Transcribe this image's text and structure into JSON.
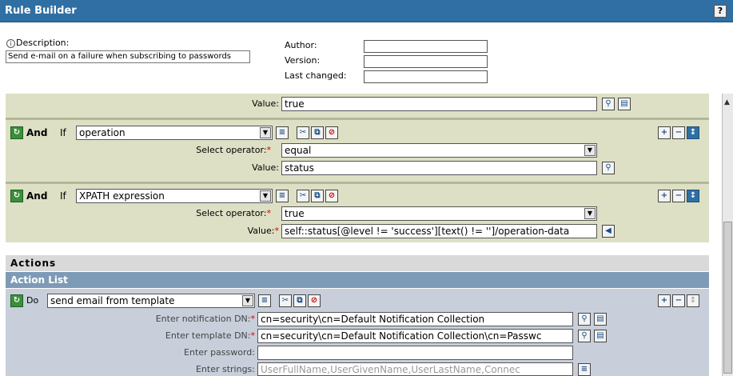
{
  "header": {
    "title": "Rule Builder",
    "help_icon": "?"
  },
  "description": {
    "label": "Description:",
    "value": "Send e-mail on a failure when subscribing to passwords"
  },
  "meta": {
    "author_label": "Author:",
    "version_label": "Version:",
    "last_changed_label": "Last changed:"
  },
  "conditions": {
    "top_value_label": "Value:",
    "top_value": "true",
    "rows": [
      {
        "conjunction": "And",
        "if_label": "If",
        "type": "operation",
        "operator_label": "Select operator:",
        "operator": "equal",
        "value_label": "Value:",
        "value": "status"
      },
      {
        "conjunction": "And",
        "if_label": "If",
        "type": "XPATH expression",
        "operator_label": "Select operator:",
        "operator": "true",
        "value_label": "Value:",
        "value": "self::status[@level != 'success'][text() != '']/operation-data"
      }
    ]
  },
  "actions": {
    "section_title": "Actions",
    "list_title": "Action List",
    "do_label": "Do",
    "action_type": "send email from template",
    "notification_label": "Enter notification DN:",
    "notification_value": "cn=security\\cn=Default Notification Collection",
    "template_label": "Enter template DN:",
    "template_value": "cn=security\\cn=Default Notification Collection\\cn=Passwc",
    "password_label": "Enter password:",
    "strings_label": "Enter strings:",
    "strings_value": "UserFullName,UserGivenName,UserLastName,Connec"
  },
  "icons": {
    "search": "search-icon",
    "browse": "browse-icon",
    "edit": "edit-list-icon",
    "add": "add-icon",
    "remove": "remove-icon",
    "move": "move-icon",
    "reload": "refresh-icon"
  },
  "colors": {
    "header": "#2f6fa3",
    "condition_bg": "#dde0c4",
    "action_bg": "#c8cfdb",
    "action_list_hdr": "#7d9bb7"
  }
}
